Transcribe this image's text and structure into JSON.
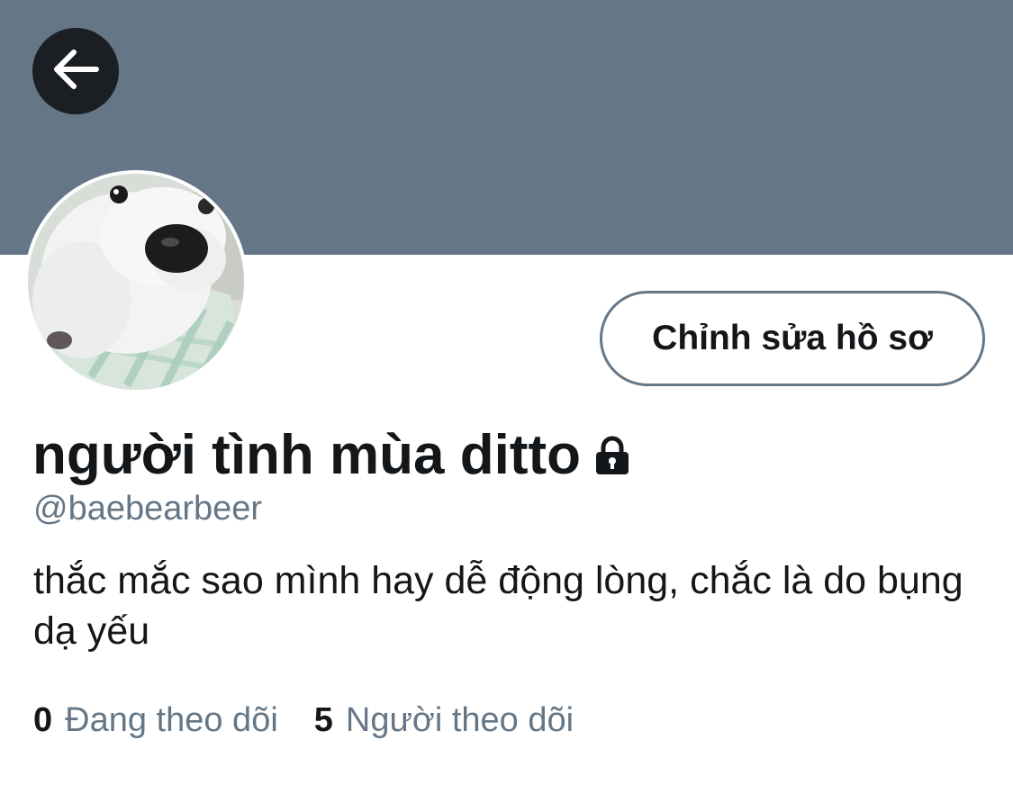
{
  "profile": {
    "display_name": "người tình mùa ditto",
    "handle": "@baebearbeer",
    "bio": "thắc mắc sao mình hay dễ động lòng, chắc là do bụng dạ yếu",
    "protected": true
  },
  "actions": {
    "edit_profile_label": "Chỉnh sửa hồ sơ"
  },
  "stats": {
    "following_count": "0",
    "following_label": "Đang theo dõi",
    "followers_count": "5",
    "followers_label": "Người theo dõi"
  },
  "icons": {
    "back": "arrow-left-icon",
    "lock": "lock-icon"
  },
  "colors": {
    "banner": "#657786",
    "text_primary": "#14171a",
    "text_secondary": "#657786"
  }
}
